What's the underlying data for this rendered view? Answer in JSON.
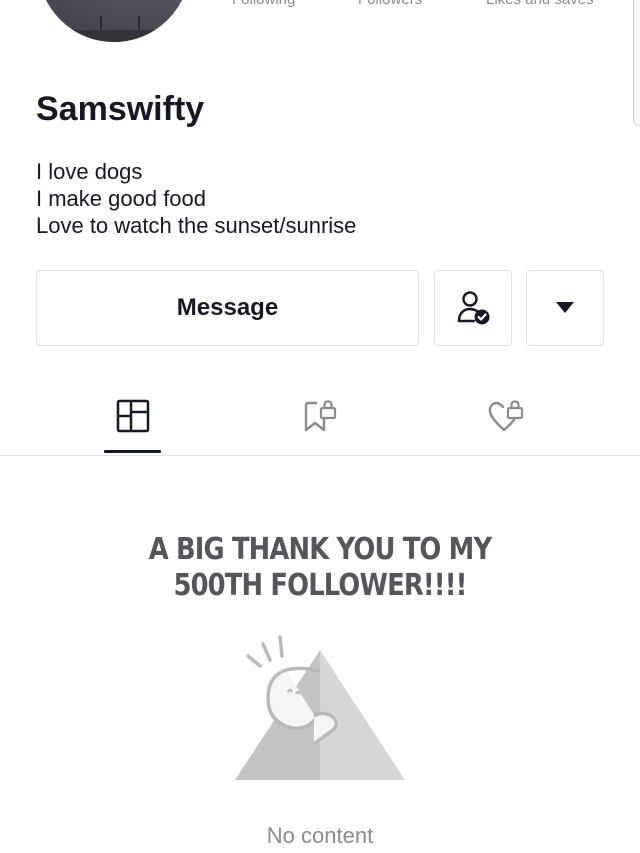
{
  "profile": {
    "username": "Samswifty",
    "bio": [
      "I love dogs",
      "I make good food",
      "Love to watch the sunset/sunrise"
    ],
    "stats_labels": [
      "Following",
      "Followers",
      "Likes and saves"
    ]
  },
  "actions": {
    "message_label": "Message"
  },
  "tabs": [
    {
      "name": "videos",
      "icon": "grid-icon",
      "active": true
    },
    {
      "name": "saved",
      "icon": "bookmark-lock-icon",
      "active": false
    },
    {
      "name": "liked",
      "icon": "heart-lock-icon",
      "active": false
    }
  ],
  "content": {
    "announcement_line1": "A BIG THANK YOU TO MY",
    "announcement_line2": "500TH FOLLOWER!!!!",
    "empty_label": "No content"
  },
  "colors": {
    "text": "#161823",
    "muted": "#8a8b91",
    "border": "#e3e3e4"
  }
}
